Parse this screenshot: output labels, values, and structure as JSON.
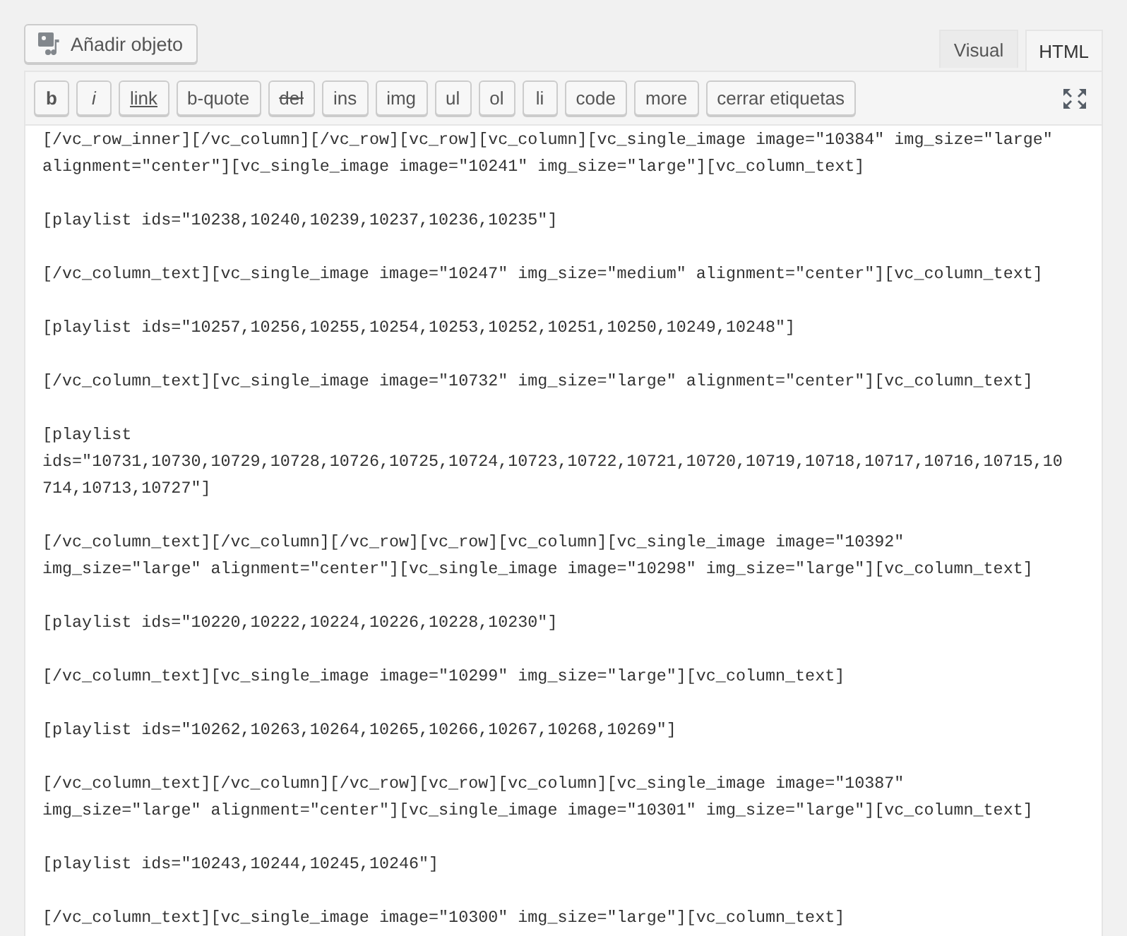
{
  "add_media_button": {
    "label": "Añadir objeto"
  },
  "editor_tabs": [
    {
      "label": "Visual",
      "selected": false
    },
    {
      "label": "HTML",
      "selected": true
    }
  ],
  "quicktags": [
    {
      "label": "b",
      "kind": "bold"
    },
    {
      "label": "i",
      "kind": "italic"
    },
    {
      "label": "link",
      "kind": "underline"
    },
    {
      "label": "b-quote",
      "kind": "plain"
    },
    {
      "label": "del",
      "kind": "strike"
    },
    {
      "label": "ins",
      "kind": "plain"
    },
    {
      "label": "img",
      "kind": "plain"
    },
    {
      "label": "ul",
      "kind": "plain"
    },
    {
      "label": "ol",
      "kind": "plain"
    },
    {
      "label": "li",
      "kind": "plain"
    },
    {
      "label": "code",
      "kind": "plain"
    },
    {
      "label": "more",
      "kind": "plain"
    },
    {
      "label": "cerrar etiquetas",
      "kind": "plain"
    }
  ],
  "content": [
    {
      "lines": [
        "[/vc_row_inner][/vc_column][/vc_row][vc_row][vc_column][vc_single_image image=\"10384\" img_size=\"large\"",
        "alignment=\"center\"][vc_single_image image=\"10241\" img_size=\"large\"][vc_column_text]"
      ]
    },
    {
      "lines": [
        "[playlist ids=\"10238,10240,10239,10237,10236,10235\"]"
      ]
    },
    {
      "lines": [
        "[/vc_column_text][vc_single_image image=\"10247\" img_size=\"medium\" alignment=\"center\"][vc_column_text]"
      ]
    },
    {
      "lines": [
        "[playlist ids=\"10257,10256,10255,10254,10253,10252,10251,10250,10249,10248\"]"
      ]
    },
    {
      "lines": [
        "[/vc_column_text][vc_single_image image=\"10732\" img_size=\"large\" alignment=\"center\"][vc_column_text]"
      ]
    },
    {
      "lines": [
        "[playlist",
        "ids=\"10731,10730,10729,10728,10726,10725,10724,10723,10722,10721,10720,10719,10718,10717,10716,10715,10",
        "714,10713,10727\"]"
      ]
    },
    {
      "lines": [
        "[/vc_column_text][/vc_column][/vc_row][vc_row][vc_column][vc_single_image image=\"10392\"",
        "img_size=\"large\" alignment=\"center\"][vc_single_image image=\"10298\" img_size=\"large\"][vc_column_text]"
      ]
    },
    {
      "lines": [
        "[playlist ids=\"10220,10222,10224,10226,10228,10230\"]"
      ]
    },
    {
      "lines": [
        "[/vc_column_text][vc_single_image image=\"10299\" img_size=\"large\"][vc_column_text]"
      ]
    },
    {
      "lines": [
        "[playlist ids=\"10262,10263,10264,10265,10266,10267,10268,10269\"]"
      ]
    },
    {
      "lines": [
        "[/vc_column_text][/vc_column][/vc_row][vc_row][vc_column][vc_single_image image=\"10387\"",
        "img_size=\"large\" alignment=\"center\"][vc_single_image image=\"10301\" img_size=\"large\"][vc_column_text]"
      ]
    },
    {
      "lines": [
        "[playlist ids=\"10243,10244,10245,10246\"]"
      ]
    },
    {
      "lines": [
        "[/vc_column_text][vc_single_image image=\"10300\" img_size=\"large\"][vc_column_text]"
      ]
    }
  ]
}
